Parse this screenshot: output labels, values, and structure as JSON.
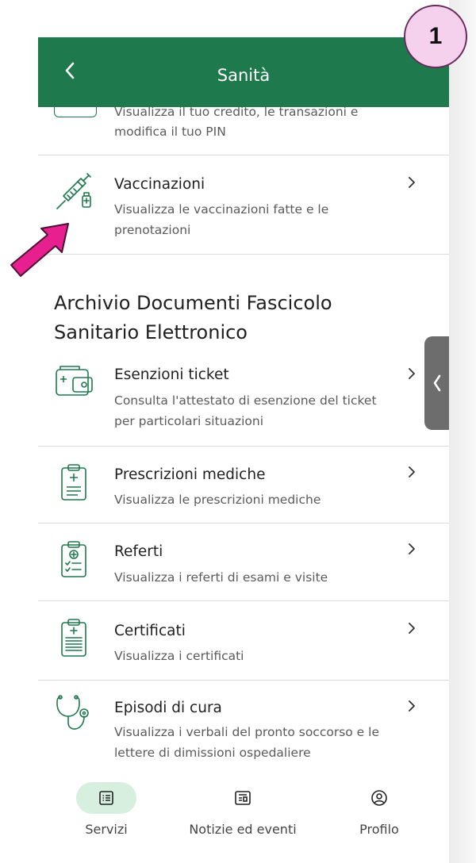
{
  "badge": "1",
  "header": {
    "title": "Sanità"
  },
  "partial_row": {
    "desc": "Visualizza il tuo credito, le transazioni e modifica il tuo PIN"
  },
  "vaccinazioni": {
    "label": "Vaccinazioni",
    "desc": "Visualizza le vaccinazioni fatte e le prenotazioni"
  },
  "section_title": "Archivio Documenti Fascicolo Sanitario Elettronico",
  "items": [
    {
      "label": "Esenzioni ticket",
      "desc": "Consulta l'attestato di esenzione del ticket per particolari situazioni",
      "icon": "wallet-medical-icon"
    },
    {
      "label": "Prescrizioni mediche",
      "desc": "Visualizza le prescrizioni mediche",
      "icon": "prescription-icon"
    },
    {
      "label": "Referti",
      "desc": "Visualizza i referti di esami e visite",
      "icon": "clipboard-report-icon"
    },
    {
      "label": "Certificati",
      "desc": "Visualizza i certificati",
      "icon": "certificate-icon"
    },
    {
      "label": "Episodi di cura",
      "desc": "Visualizza i verbali del pronto soccorso e le lettere di dimissioni ospedaliere",
      "icon": "stethoscope-icon"
    }
  ],
  "nav": [
    {
      "label": "Servizi",
      "icon": "services-list-icon",
      "active": true
    },
    {
      "label": "Notizie ed eventi",
      "icon": "news-icon",
      "active": false
    },
    {
      "label": "Profilo",
      "icon": "profile-icon",
      "active": false
    }
  ],
  "colors": {
    "header_green": "#1e7a4d",
    "icon_green": "#1e7a4d",
    "nav_active": "#d6efdf",
    "badge_fill": "#f6d1ee",
    "arrow_pink": "#e8208f",
    "side_tab": "#6d6d6d"
  }
}
